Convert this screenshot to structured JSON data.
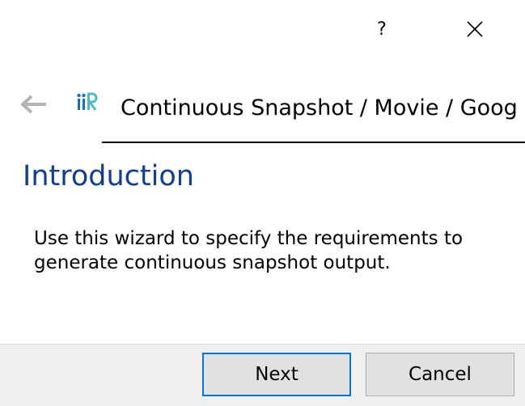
{
  "titlebar": {
    "help_label": "?"
  },
  "header": {
    "title": "Continuous Snapshot / Movie / Goog"
  },
  "page": {
    "title": "Introduction",
    "description": "Use this wizard to specify the requirements to generate continuous snapshot output."
  },
  "footer": {
    "next_label": "Next",
    "cancel_label": "Cancel"
  },
  "colors": {
    "title_blue": "#0f3f8f",
    "focus_blue": "#0078d7",
    "logo_blue": "#1a6fc2",
    "logo_teal": "#4fb8c7"
  }
}
